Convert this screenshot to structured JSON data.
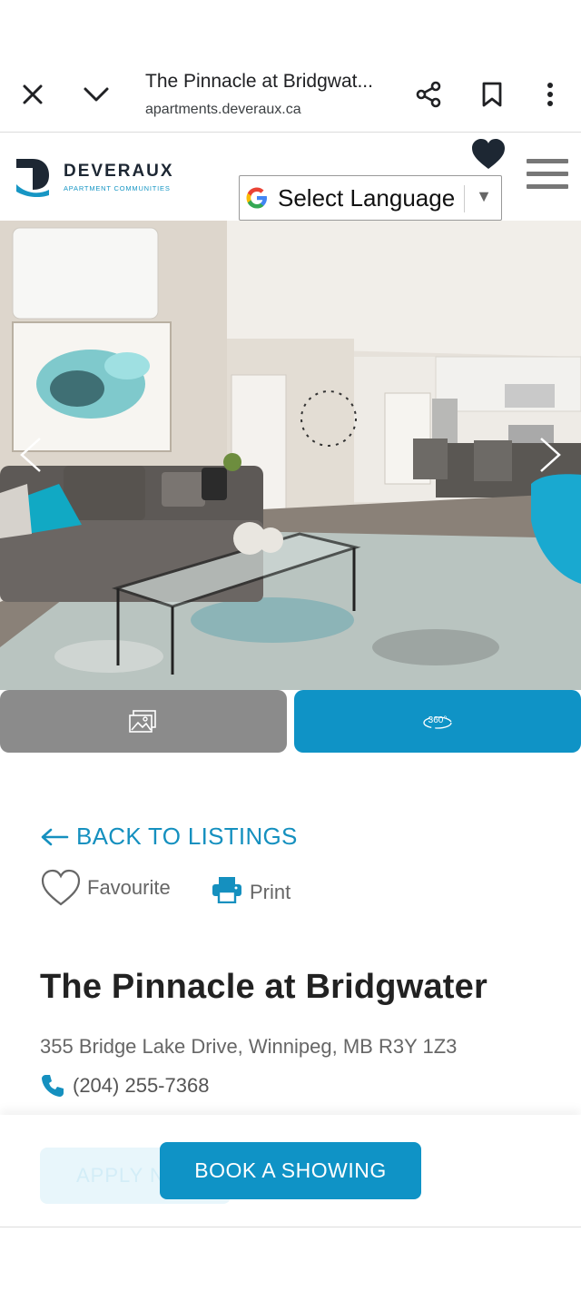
{
  "browser": {
    "page_title": "The Pinnacle at Bridgwat...",
    "url": "apartments.deveraux.ca"
  },
  "header": {
    "logo_name": "DEVERAUX",
    "logo_sub": "APARTMENT COMMUNITIES",
    "language_select": "Select Language"
  },
  "media": {
    "photos_icon": "image-gallery-icon",
    "tour_icon": "360-view-icon"
  },
  "content": {
    "back_label": "BACK TO LISTINGS",
    "favourite_label": "Favourite",
    "print_label": "Print",
    "property_name": "The Pinnacle at Bridgwater",
    "address": "355 Bridge Lake Drive, Winnipeg, MB R3Y 1Z3",
    "phone": "(204) 255-7368"
  },
  "cta": {
    "apply_label": "APPLY N",
    "book_label": "BOOK A SHOWING"
  },
  "colors": {
    "accent": "#0f93c6",
    "photos_button": "#8b8b8b"
  }
}
